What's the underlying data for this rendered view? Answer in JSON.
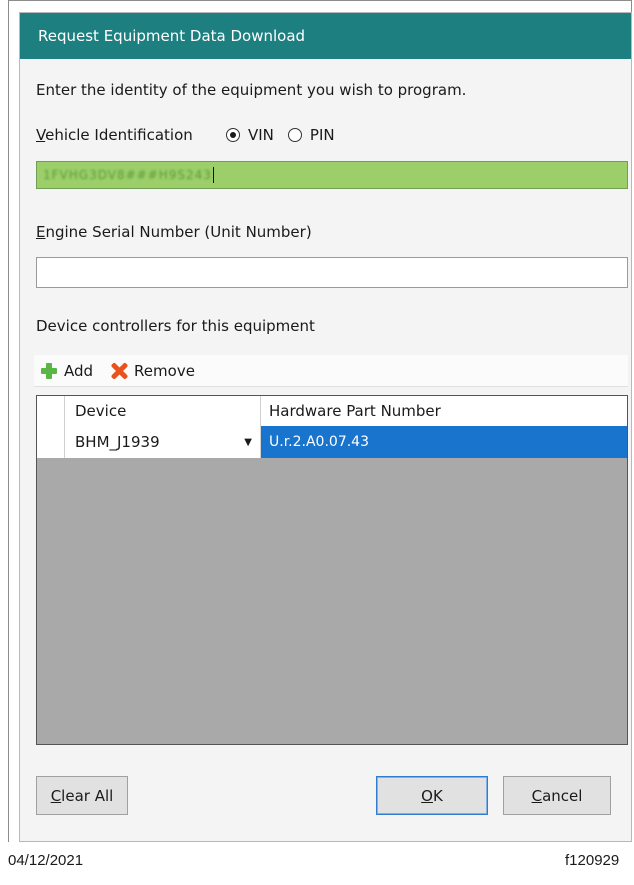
{
  "dialog": {
    "title": "Request Equipment Data Download",
    "instruction": "Enter the identity of the equipment you wish to program.",
    "vehicle_id": {
      "label": "Vehicle Identification",
      "options": [
        "VIN",
        "PIN"
      ],
      "selected": "VIN",
      "value": "1FVHG3DV8###H9S243"
    },
    "esn": {
      "label": "Engine Serial Number (Unit Number)",
      "value": ""
    },
    "controllers": {
      "label": "Device controllers for this equipment",
      "toolbar": {
        "add": "Add",
        "remove": "Remove"
      },
      "columns": [
        "Device",
        "Hardware Part Number"
      ],
      "rows": [
        {
          "device": "BHM_J1939",
          "hardware_part_number": "U.r.2.A0.07.43"
        }
      ]
    },
    "buttons": {
      "clear_all": "Clear All",
      "ok": "OK",
      "cancel": "Cancel"
    }
  },
  "footer": {
    "date": "04/12/2021",
    "code": "f120929"
  },
  "colors": {
    "titlebar": "#1d7f80",
    "vin_field": "#9ccf6a",
    "selection": "#1874cc",
    "grid_empty": "#a9a9a9"
  },
  "icons": {
    "add": "plus-icon",
    "remove": "x-icon"
  }
}
